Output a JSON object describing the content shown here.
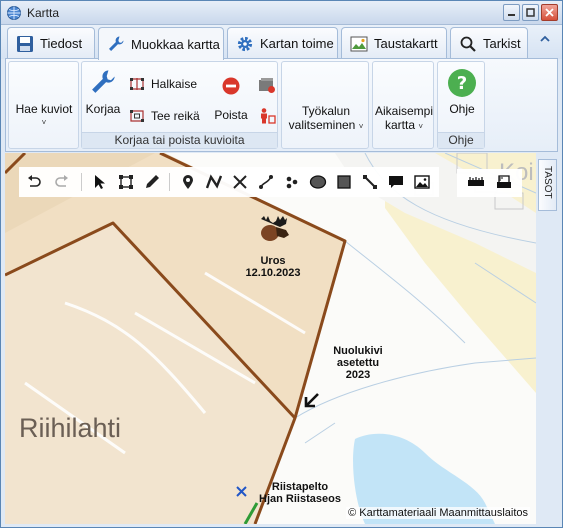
{
  "window": {
    "title": "Kartta"
  },
  "tabs": [
    {
      "label": "Tiedost",
      "icon": "save-icon"
    },
    {
      "label": "Muokkaa kartta",
      "icon": "wrench-icon",
      "active": true
    },
    {
      "label": "Kartan toime",
      "icon": "gear-icon"
    },
    {
      "label": "Taustakartt",
      "icon": "map-image-icon"
    },
    {
      "label": "Tarkist",
      "icon": "magnifier-icon"
    }
  ],
  "ribbon": {
    "hae_kuviot": "Hae kuviot",
    "korjaa": "Korjaa",
    "halkaise": "Halkaise",
    "tee_reika": "Tee reikä",
    "poista": "Poista",
    "group_korjaa": "Korjaa tai poista kuvioita",
    "tyokalun_line1": "Työkalun",
    "tyokalun_line2": "valitseminen",
    "aikaisempi_line1": "Aikaisempi",
    "aikaisempi_line2": "kartta",
    "ohje": "Ohje",
    "group_ohje": "Ohje"
  },
  "map": {
    "moose_label_line1": "Uros",
    "moose_label_line2": "12.10.2023",
    "salt_label_line1": "Nuolukivi",
    "salt_label_line2": "asetettu",
    "salt_label_line3": "2023",
    "field_label_line1": "Riistapelto",
    "field_label_line2": "Hjan Riistaseos",
    "place_riihilahti": "Riihilahti",
    "place_koi": "Koi",
    "copyright": "© Karttamateriaali Maanmittauslaitos"
  },
  "sidepanel": {
    "tab": "TASOT"
  },
  "colors": {
    "accent": "#3d6fb0",
    "boundary": "#8a4a1c",
    "field": "#f1dfc3",
    "water": "#c2e4f7"
  }
}
